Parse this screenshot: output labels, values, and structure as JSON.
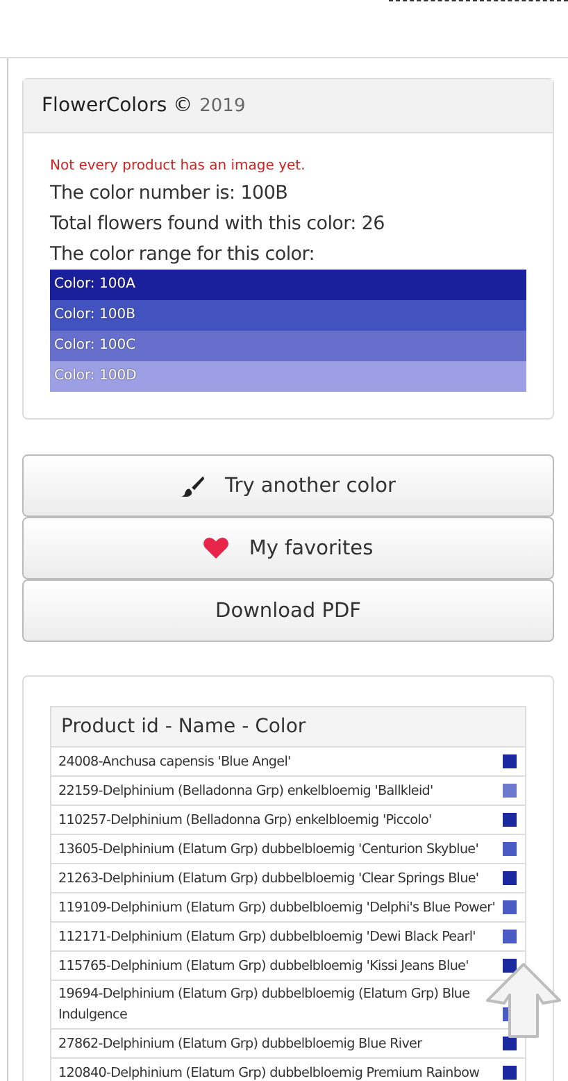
{
  "header": {
    "brand": "FlowerColors ©",
    "year": "2019"
  },
  "notice": "Not every product has an image yet.",
  "info": [
    "The color number is: 100B",
    "Total flowers found with this color: 26",
    "The color range for this color:"
  ],
  "color_range": [
    {
      "label": "Color: 100A",
      "color": "#1a1f9c"
    },
    {
      "label": "Color: 100B",
      "color": "#4252bf"
    },
    {
      "label": "Color: 100C",
      "color": "#6670cc"
    },
    {
      "label": "Color: 100D",
      "color": "#9c9fe3"
    }
  ],
  "buttons": [
    {
      "kind": "brush",
      "label": "Try another color"
    },
    {
      "kind": "heart",
      "label": "My favorites"
    },
    {
      "kind": "plain",
      "label": "Download PDF"
    }
  ],
  "table": {
    "heading": "Product id - Name - Color",
    "rows": [
      {
        "text": "24008-Anchusa capensis 'Blue Angel'",
        "color": "#1a2a9e"
      },
      {
        "text": "22159-Delphinium (Belladonna Grp) enkelbloemig 'Ballkleid'",
        "color": "#6b78cc"
      },
      {
        "text": "110257-Delphinium (Belladonna Grp) enkelbloemig 'Piccolo'",
        "color": "#1a2a9e"
      },
      {
        "text": "13605-Delphinium (Elatum Grp) dubbelbloemig 'Centurion Skyblue'",
        "color": "#4a5cc4"
      },
      {
        "text": "21263-Delphinium (Elatum Grp) dubbelbloemig 'Clear Springs Blue'",
        "color": "#1a2a9e"
      },
      {
        "text": "119109-Delphinium (Elatum Grp) dubbelbloemig 'Delphi's Blue Power'",
        "color": "#4a5cc4"
      },
      {
        "text": "112171-Delphinium (Elatum Grp) dubbelbloemig 'Dewi Black Pearl'",
        "color": "#4a5cc4"
      },
      {
        "text": "115765-Delphinium (Elatum Grp) dubbelbloemig 'Kissi Jeans Blue'",
        "color": "#1a2a9e"
      },
      {
        "text": "19694-Delphinium (Elatum Grp) dubbelbloemig (Elatum Grp) Blue Indulgence",
        "color": "#4a5cc4"
      },
      {
        "text": "27862-Delphinium (Elatum Grp) dubbelbloemig Blue River",
        "color": "#1a2a9e"
      },
      {
        "text": "120840-Delphinium (Elatum Grp) dubbelbloemig Premium Rainbow",
        "color": "#1a2a9e"
      }
    ]
  }
}
